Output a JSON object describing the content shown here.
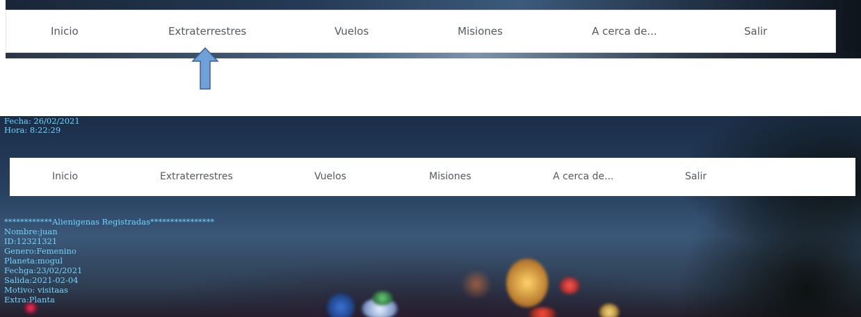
{
  "top_nav": {
    "items": [
      {
        "label": "Inicio"
      },
      {
        "label": "Extraterrestres"
      },
      {
        "label": "Vuelos"
      },
      {
        "label": "Misiones"
      },
      {
        "label": "A cerca de..."
      },
      {
        "label": "Salir"
      }
    ]
  },
  "header": {
    "fecha": "Fecha: 26/02/2021",
    "hora": "Hora: 8:22:29"
  },
  "main_nav": {
    "items": [
      {
        "label": "Inicio"
      },
      {
        "label": "Extraterrestres"
      },
      {
        "label": "Vuelos"
      },
      {
        "label": "Misiones"
      },
      {
        "label": "A cerca de..."
      },
      {
        "label": "Salir"
      }
    ]
  },
  "registry": {
    "title": "************Alienigenas Registradas****************",
    "nombre": "Nombre:juan",
    "id": "ID:12321321",
    "genero": "Genero:Femenino",
    "planeta": "Planeta:mogul",
    "fecha": "Fechga:23/02/2021",
    "salida": "Salida:2021-02-04",
    "motivo": "Motivo: visitaas",
    "extra": "Extra:Planta"
  },
  "colors": {
    "text_cyan": "#6fd6ff",
    "nav_text": "#555a60",
    "arrow_fill": "#6fa0d8",
    "arrow_stroke": "#3a5f9a"
  }
}
